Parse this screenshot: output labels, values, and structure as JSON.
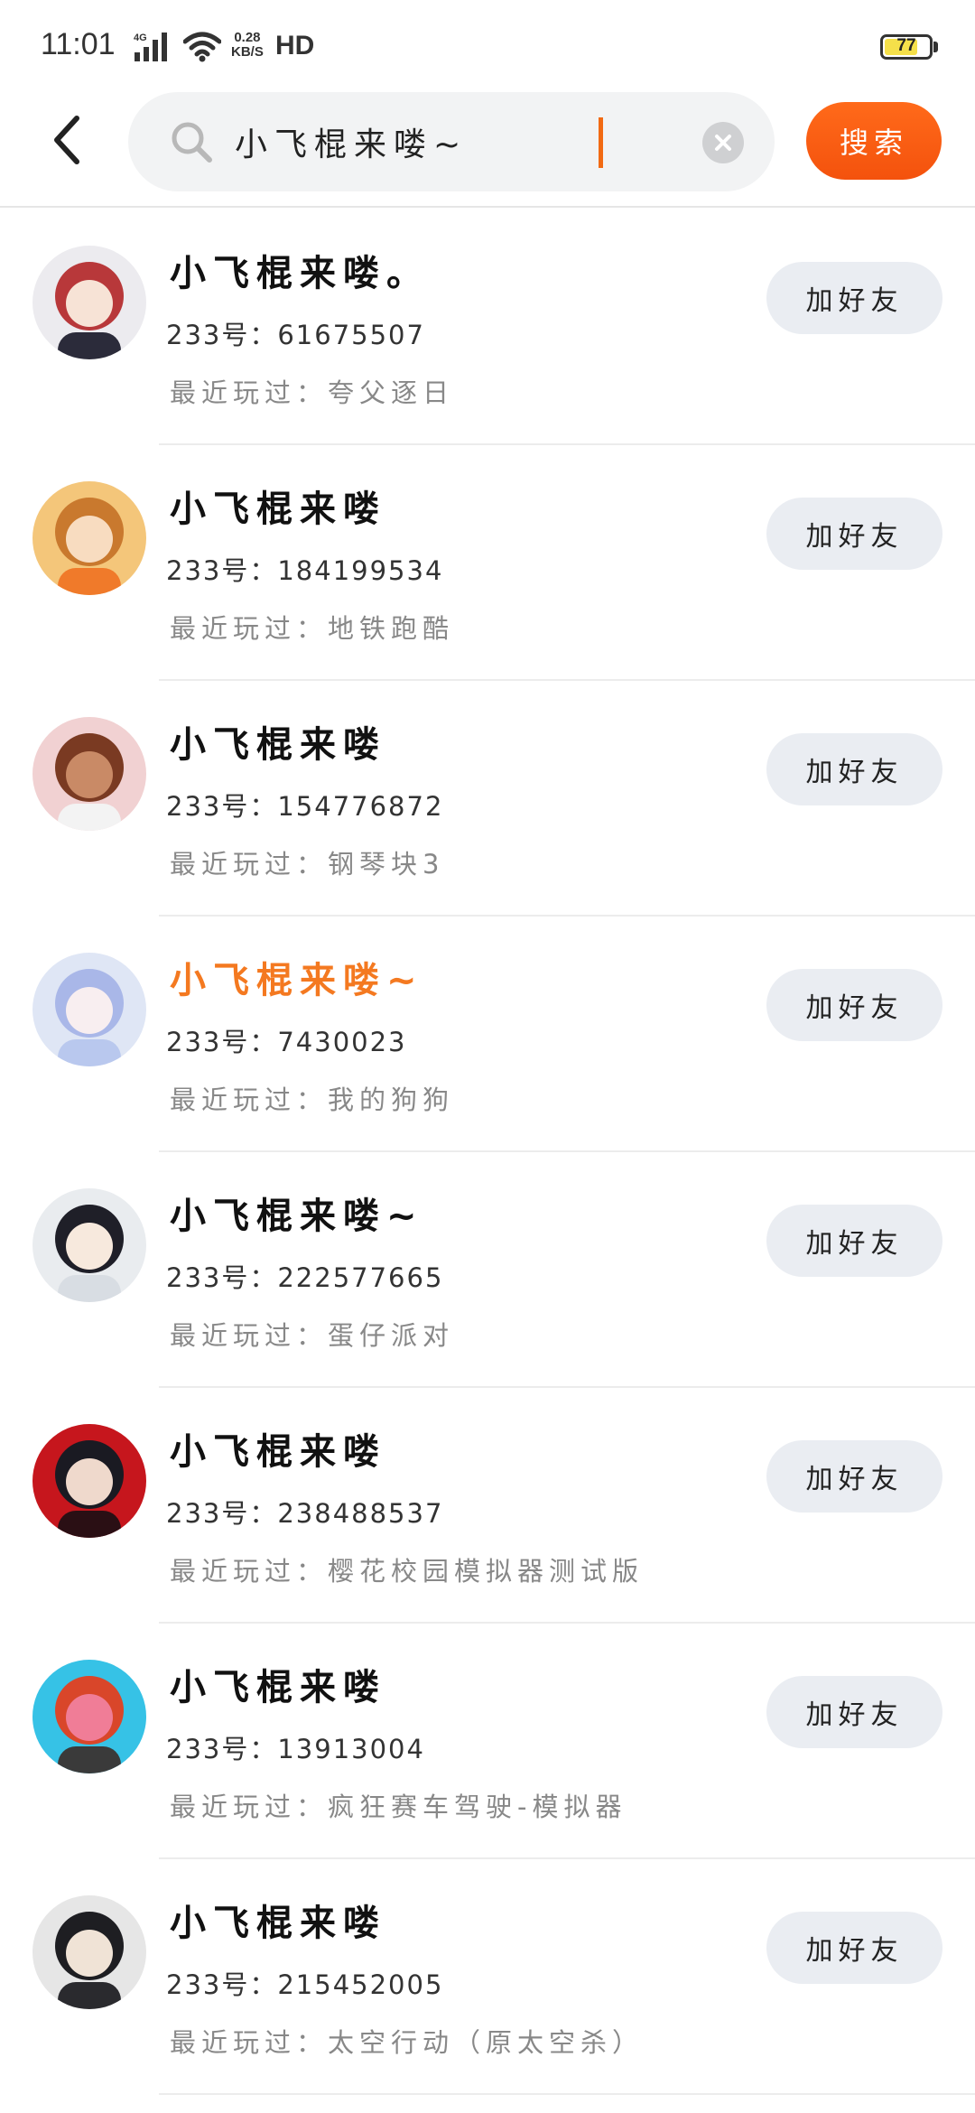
{
  "status_bar": {
    "time": "11:01",
    "network": "4G",
    "speed_value": "0.28",
    "speed_unit": "KB/S",
    "hd": "HD",
    "battery": "77",
    "battery_level": 0.77,
    "battery_color": "#f5e04a"
  },
  "header": {
    "back_icon": "chevron-left-icon",
    "search_icon": "search-icon",
    "search_value": "小飞棍来喽~",
    "clear_icon": "close-icon",
    "search_button_label": "搜索",
    "accent_color": "#f4520d"
  },
  "results": [
    {
      "name": "小飞棍来喽。",
      "id": "233号：61675507",
      "recent": "最近玩过：夸父逐日",
      "button": "加好友",
      "highlight": false
    },
    {
      "name": "小飞棍来喽",
      "id": "233号：184199534",
      "recent": "最近玩过：地铁跑酷",
      "button": "加好友",
      "highlight": false
    },
    {
      "name": "小飞棍来喽",
      "id": "233号：154776872",
      "recent": "最近玩过：钢琴块3",
      "button": "加好友",
      "highlight": false
    },
    {
      "name": "小飞棍来喽~",
      "id": "233号：7430023",
      "recent": "最近玩过：我的狗狗",
      "button": "加好友",
      "highlight": true
    },
    {
      "name": "小飞棍来喽~",
      "id": "233号：222577665",
      "recent": "最近玩过：蛋仔派对",
      "button": "加好友",
      "highlight": false
    },
    {
      "name": "小飞棍来喽",
      "id": "233号：238488537",
      "recent": "最近玩过：樱花校园模拟器测试版",
      "button": "加好友",
      "highlight": false
    },
    {
      "name": "小飞棍来喽",
      "id": "233号：13913004",
      "recent": "最近玩过：疯狂赛车驾驶-模拟器",
      "button": "加好友",
      "highlight": false
    },
    {
      "name": "小飞棍来喽",
      "id": "233号：215452005",
      "recent": "最近玩过：太空行动（原太空杀）",
      "button": "加好友",
      "highlight": false
    }
  ]
}
